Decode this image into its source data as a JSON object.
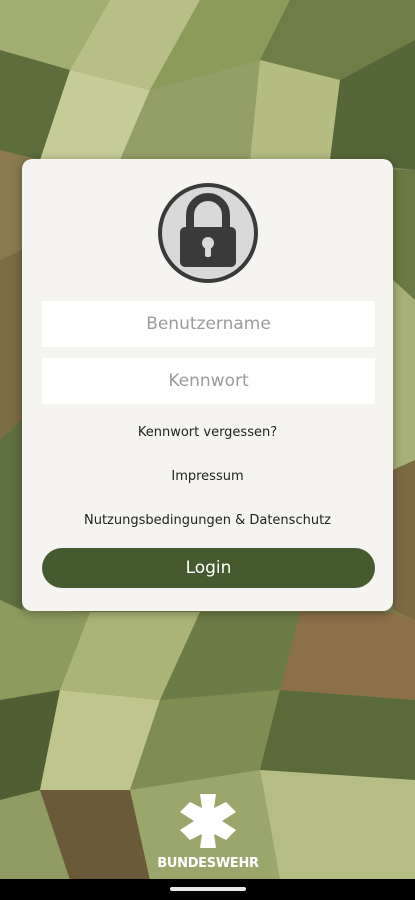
{
  "login": {
    "username_placeholder": "Benutzername",
    "password_placeholder": "Kennwort",
    "forgot_password": "Kennwort vergessen?",
    "imprint": "Impressum",
    "terms_privacy": "Nutzungsbedingungen & Datenschutz",
    "login_button": "Login",
    "lock_icon": "padlock-icon"
  },
  "branding": {
    "name": "BUNDESWEHR",
    "logo_icon": "iron-cross-icon"
  },
  "colors": {
    "button": "#455a2e",
    "card": "#f5f4f1"
  }
}
